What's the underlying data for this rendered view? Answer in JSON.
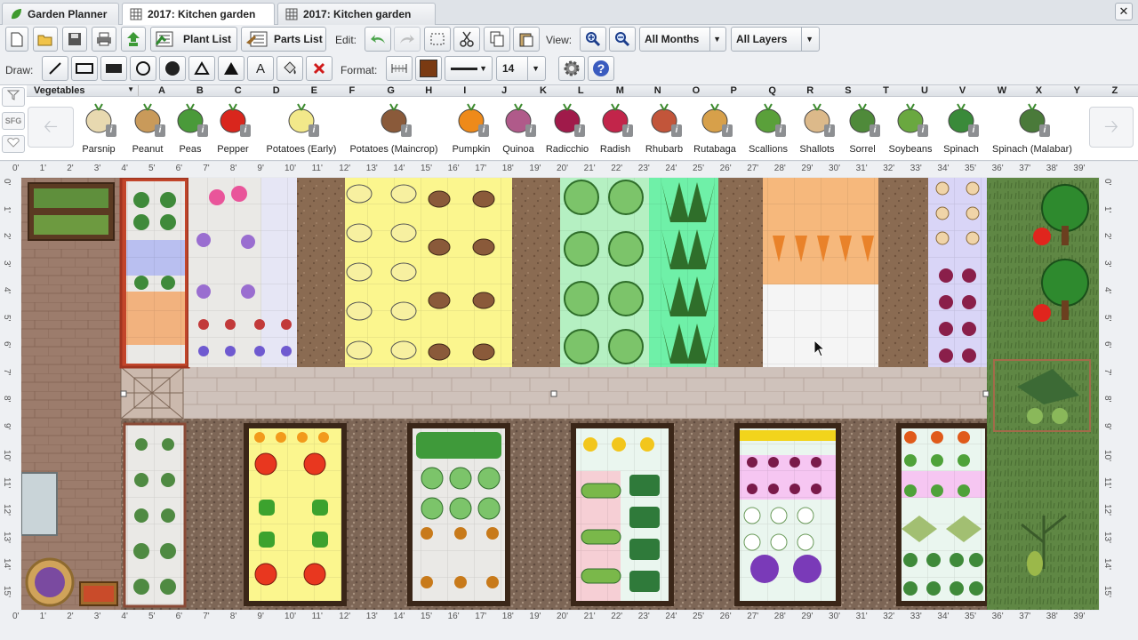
{
  "tabs": [
    {
      "label": "Garden Planner",
      "icon": "leaf-icon"
    },
    {
      "label": "2017: Kitchen garden",
      "icon": "grid-icon"
    },
    {
      "label": "2017: Kitchen garden",
      "icon": "grid-icon"
    }
  ],
  "toolbar": {
    "plant_list": "Plant List",
    "parts_list": "Parts List",
    "edit_label": "Edit:",
    "view_label": "View:",
    "months_value": "All Months",
    "layers_value": "All Layers",
    "draw_label": "Draw:",
    "format_label": "Format:",
    "font_size": "14",
    "text_tool": "A"
  },
  "plant_bar": {
    "category": "Vegetables",
    "columns": [
      "A",
      "B",
      "C",
      "D",
      "E",
      "F",
      "G",
      "H",
      "I",
      "J",
      "K",
      "L",
      "M",
      "N",
      "O",
      "P",
      "Q",
      "R",
      "S",
      "T",
      "U",
      "V",
      "W",
      "X",
      "Y",
      "Z"
    ],
    "plants": [
      "Parsnip",
      "Peanut",
      "Peas",
      "Pepper",
      "Potatoes (Early)",
      "Potatoes (Maincrop)",
      "Pumpkin",
      "Quinoa",
      "Radicchio",
      "Radish",
      "Rhubarb",
      "Rutabaga",
      "Scallions",
      "Shallots",
      "Sorrel",
      "Soybeans",
      "Spinach",
      "Spinach (Malabar)"
    ],
    "sfg_label": "SFG"
  },
  "ruler": {
    "top": [
      "0'",
      "1'",
      "2'",
      "3'",
      "4'",
      "5'",
      "6'",
      "7'",
      "8'",
      "9'",
      "10'",
      "11'",
      "12'",
      "13'",
      "14'",
      "15'",
      "16'",
      "17'",
      "18'",
      "19'",
      "20'",
      "21'",
      "22'",
      "23'",
      "24'",
      "25'",
      "26'",
      "27'",
      "28'",
      "29'",
      "30'",
      "31'",
      "32'",
      "33'",
      "34'",
      "35'",
      "36'",
      "37'",
      "38'",
      "39'"
    ],
    "side": [
      "0'",
      "1'",
      "2'",
      "3'",
      "4'",
      "5'",
      "6'",
      "7'",
      "8'",
      "9'",
      "10'",
      "11'",
      "12'",
      "13'",
      "14'",
      "15'"
    ]
  },
  "colors": {
    "soil": "#8a6b52",
    "path": "#cbbdb5",
    "grass": "#5f8744"
  }
}
